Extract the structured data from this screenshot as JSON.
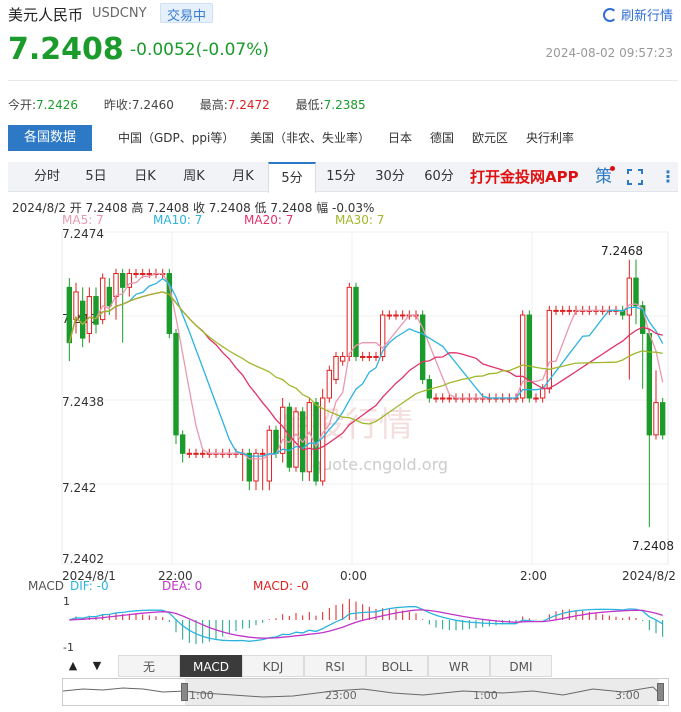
{
  "header": {
    "name": "美元人民币",
    "code": "USDCNY",
    "status": "交易中",
    "refresh_label": "刷新行情"
  },
  "quote": {
    "price": "7.2408",
    "change": "-0.0052(-0.07%)",
    "time": "2024-08-02 09:57:23",
    "open_label": "今开:",
    "open": "7.2426",
    "prev_close_label": "昨收:",
    "prev_close": "7.2460",
    "high_label": "最高:",
    "high": "7.2472",
    "low_label": "最低:",
    "low": "7.2385"
  },
  "data_tabs": [
    "各国数据",
    "中国（GDP、ppi等）",
    "美国（非农、失业率）",
    "日本",
    "德国",
    "欧元区",
    "央行利率"
  ],
  "period_tabs": [
    "分时",
    "5日",
    "日K",
    "周K",
    "月K",
    "5分",
    "15分",
    "30分",
    "60分"
  ],
  "period_active": "5分",
  "app_link": "打开金投网APP",
  "ce_label": "策",
  "more_label": "⋮",
  "candle_info": "2024/8/2  开 7.2408  高 7.2408  收 7.2408  低 7.2408  幅 -0.03%",
  "ma_legend": [
    {
      "label": "MA5: 7",
      "color": "#e899b0"
    },
    {
      "label": "MA10: 7",
      "color": "#2bb3e0"
    },
    {
      "label": "MA20: 7",
      "color": "#e0336a"
    },
    {
      "label": "MA30: 7",
      "color": "#a0b82a"
    }
  ],
  "watermark": {
    "text": "金投行情",
    "url": "quote.cngold.org"
  },
  "chart_data": {
    "type": "candlestick",
    "y_ticks": [
      "7.2474",
      "7.245",
      "7.2438",
      "7.242",
      "7.2402"
    ],
    "x_ticks": [
      "2024/8/1",
      "22:00",
      "0:00",
      "2:00",
      "2024/8/2"
    ],
    "ylim": [
      7.2402,
      7.2474
    ],
    "max_marker": "7.2468",
    "last_marker": "7.2408"
  },
  "macd": {
    "title": "MACD",
    "dif_label": "DIF: -0",
    "dea_label": "DEA: 0",
    "macd_label": "MACD: -0",
    "ticks": [
      "1",
      "-1"
    ]
  },
  "indicator_tabs": [
    "无",
    "MACD",
    "KDJ",
    "RSI",
    "BOLL",
    "WR",
    "DMI"
  ],
  "indicator_active": "MACD",
  "arrow_up": "▲",
  "arrow_down": "▼",
  "navigator_ticks": [
    "1:00",
    "23:00",
    "1:00",
    "3:00"
  ],
  "colors": {
    "up": "#e02020",
    "down": "#1a9b2b",
    "accent": "#2e79c5"
  }
}
